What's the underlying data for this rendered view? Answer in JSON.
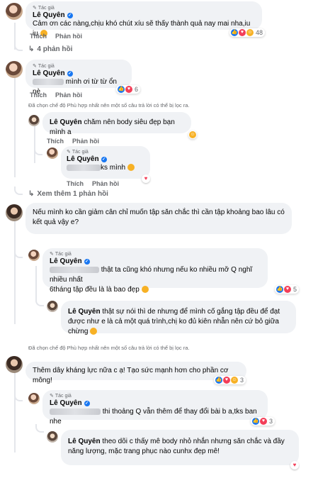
{
  "labels": {
    "author_tag": "Tác giả",
    "like": "Thích",
    "reply": "Phản hồi",
    "filter_notice": "Đã chọn chế độ Phù hợp nhất nên một số câu trả lời có thể bị lọc ra."
  },
  "icons": {
    "verified": "verified-badge-icon",
    "reply_arrow": "reply-arrow-icon",
    "like": "like-icon",
    "love": "love-icon",
    "haha": "haha-icon",
    "care": "care-icon"
  },
  "colors": {
    "bubble": "#f0f2f5",
    "name": "#050505",
    "muted": "#65676b",
    "like": "#1877f2",
    "love": "#f33e58",
    "haha": "#f7b125"
  },
  "c1": {
    "name": "Lê Quyên",
    "text": "Cảm ơn các nàng,chịu khó chút xíu sẽ thấy thành quả nay mai nha,iu iu",
    "reaction_count": "48",
    "view_replies": "4 phản hồi"
  },
  "c2": {
    "name": "Lê Quyên",
    "text": "mình ơi từ từ ổn nè",
    "reaction_count": "6"
  },
  "c3": {
    "name": "Lê Quyên",
    "text": "chăm nên body siêu đẹp bạn mình a"
  },
  "c4": {
    "name": "Lê Quyên",
    "text_suffix": "ks mình",
    "view_more": "Xem thêm 1 phản hồi"
  },
  "c5": {
    "text": "Nếu mình ko cần giảm cân chỉ muốn tập săn chắc thì cần tập khoảng bao lâu có kết quả vậy e?"
  },
  "c6": {
    "name": "Lê Quyên",
    "text_suffix": "thật ta cũng khó nhưng nếu ko nhiều mỡ Q nghĩ nhiều nhất",
    "text_line2": "6tháng tập đều là là bao đẹp",
    "reaction_count": "5"
  },
  "c7": {
    "name": "Lê Quyên",
    "text": "thật sự nói thì de nhưng để mình cố gắng tập đều để đạt được như e là cả một quá trình,chị ko đủ kiên nhẫn nên cứ bỏ giữa chừng"
  },
  "c8": {
    "text": "Thêm dây kháng lực nữa c ạ! Tạo sức mạnh hơn cho phần cơ mông!",
    "reaction_count": "3"
  },
  "c9": {
    "name": "Lê Quyên",
    "text_suffix": "thi thoảng Q vẫn thêm để thay đổi bài b a,tks ban nhe",
    "reaction_count": "3"
  },
  "c10": {
    "name": "Lê Quyên",
    "text": "theo dõi c thấy mê body nhỏ nhắn nhưng săn chắc và đầy năng lượng, mặc trang phục nào cunhx đẹp mê!"
  }
}
